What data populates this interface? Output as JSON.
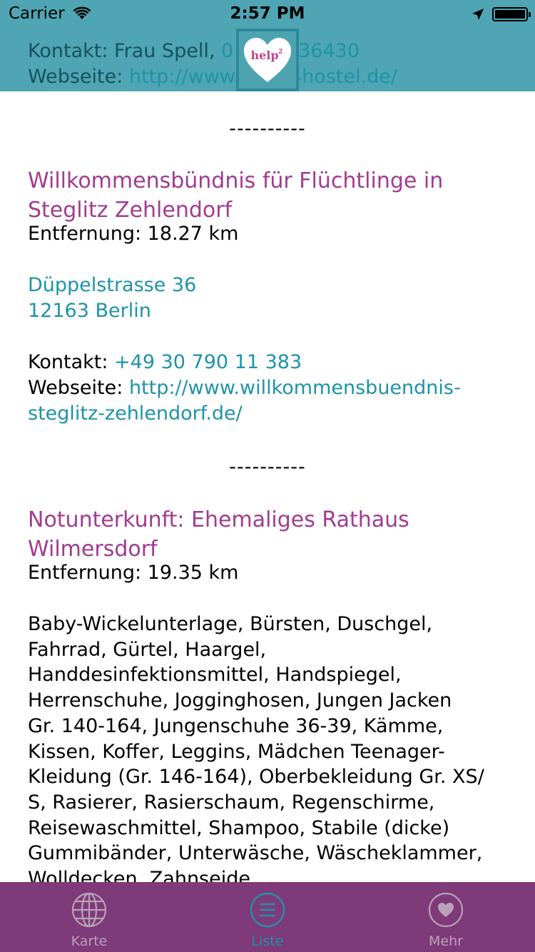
{
  "status_bar": {
    "carrier": "Carrier",
    "time": "2:57 PM"
  },
  "header": {
    "contact_label": "Kontakt: Frau Spell,",
    "contact_phone_start": "0",
    "contact_phone_end": "0 736430",
    "website_label": "Webseite:",
    "website_start": "http://www.",
    "website_end": "4hostel.de/",
    "logo_text": "help",
    "logo_sup": "2"
  },
  "separator": "----------",
  "entries": [
    {
      "title_line1": "Willkommensbündnis für Flüchtlinge in",
      "title_line2": "Steglitz Zehlendorf",
      "distance": "Entfernung: 18.27 km",
      "address_line1": "Düppelstrasse 36",
      "address_line2": "12163 Berlin",
      "contact_label": "Kontakt:",
      "contact_phone": "+49 30 790 11 383",
      "website_label": "Webseite:",
      "website_line1": "http://www.willkommensbuendnis-",
      "website_line2": "steglitz-zehlendorf.de/"
    },
    {
      "title_line1": "Notunterkunft: Ehemaliges Rathaus",
      "title_line2": "Wilmersdorf",
      "distance": "Entfernung: 19.35 km",
      "needs_lines": [
        "Baby-Wickelunterlage, Bürsten, Duschgel,",
        "Fahrrad, Gürtel, Haargel,",
        "Handdesinfektionsmittel, Handspiegel,",
        "Herrenschuhe, Jogginghosen, Jungen Jacken",
        "Gr. 140-164, Jungenschuhe 36-39, Kämme,",
        "Kissen, Koffer, Leggins, Mädchen Teenager-",
        "Kleidung (Gr. 146-164), Oberbekleidung Gr. XS/",
        "S, Rasierer, Rasierschaum, Regenschirme,",
        "Reisewaschmittel, Shampoo, Stabile (dicke)",
        "Gummibänder, Unterwäsche, Wäscheklammer,",
        "Wolldecken, Zahnseide"
      ]
    }
  ],
  "tabs": [
    {
      "label": "Karte",
      "icon": "globe-icon"
    },
    {
      "label": "Liste",
      "icon": "list-icon"
    },
    {
      "label": "Mehr",
      "icon": "heart-icon"
    }
  ],
  "colors": {
    "header_bg": "#4fa5b3",
    "title": "#a13c8f",
    "link": "#1e93a8",
    "tab_bar_bg": "#7f3a7a",
    "tab_active": "#1e93a8",
    "tab_inactive": "#b9a2b8"
  }
}
